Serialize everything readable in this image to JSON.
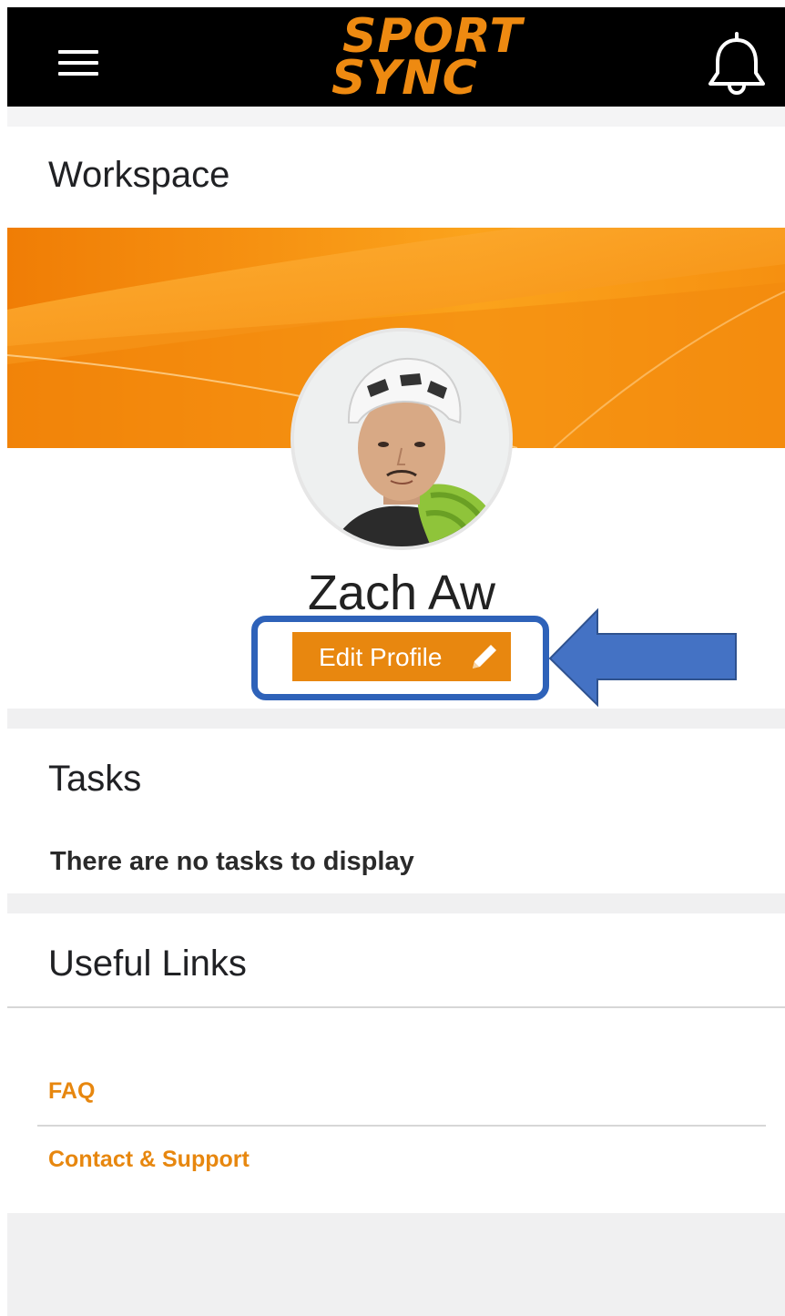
{
  "header": {
    "logo_line1": "SPORT",
    "logo_line2": "SYNC",
    "menu_icon": "hamburger-menu-icon",
    "notification_icon": "bell-icon"
  },
  "workspace": {
    "title": "Workspace"
  },
  "profile": {
    "name": "Zach Aw",
    "edit_label": "Edit Profile",
    "edit_icon": "pencil-icon"
  },
  "tasks": {
    "title": "Tasks",
    "empty_message": "There are no tasks to display"
  },
  "useful_links": {
    "title": "Useful Links",
    "items": [
      {
        "label": "FAQ"
      },
      {
        "label": "Contact & Support"
      }
    ]
  },
  "colors": {
    "brand_orange": "#e8870f",
    "header_bg": "#000000",
    "highlight_blue": "#2e62b9",
    "arrow_blue": "#4472c4"
  }
}
